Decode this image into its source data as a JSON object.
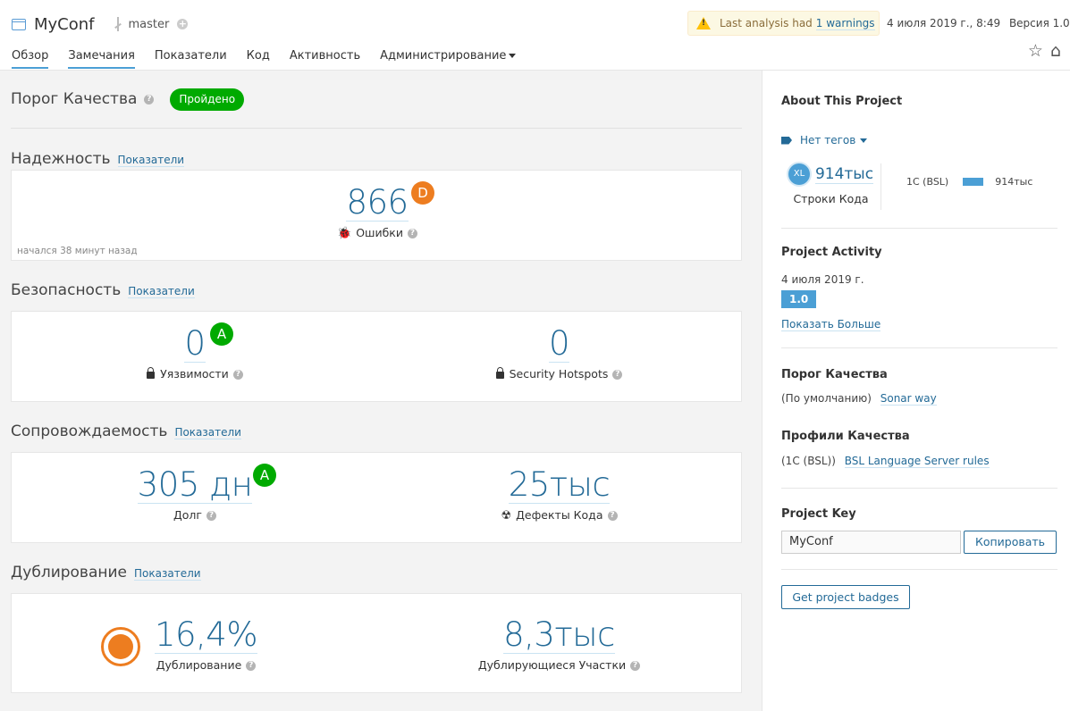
{
  "header": {
    "project_name": "MyConf",
    "branch": "master",
    "warning_text": "Last analysis had",
    "warning_link": "1 warnings",
    "date": "4 июля 2019 г., 8:49",
    "version": "Версия 1.0",
    "nav": [
      "Обзор",
      "Замечания",
      "Показатели",
      "Код",
      "Активность",
      "Администрирование"
    ],
    "icons": [
      "star-icon",
      "home-icon"
    ]
  },
  "quality_gate": {
    "title": "Порог Качества",
    "status": "Пройдено",
    "status_color": "#00aa00"
  },
  "reliability": {
    "title": "Надежность",
    "link": "Показатели",
    "bugs": "866",
    "bugs_rating": "D",
    "bugs_label": "Ошибки",
    "started": "начался 38 минут назад"
  },
  "security": {
    "title": "Безопасность",
    "link": "Показатели",
    "vulnerabilities": "0",
    "vuln_rating": "A",
    "vuln_label": "Уязвимости",
    "hotspots": "0",
    "hotspots_label": "Security Hotspots"
  },
  "maintainability": {
    "title": "Сопровождаемость",
    "link": "Показатели",
    "debt": "305 дн",
    "debt_rating": "A",
    "debt_label": "Долг",
    "smells": "25тыс",
    "smells_label": "Дефекты Кода"
  },
  "duplication": {
    "title": "Дублирование",
    "link": "Показатели",
    "density": "16,4%",
    "density_label": "Дублирование",
    "blocks": "8,3тыс",
    "blocks_label": "Дублирующиеся Участки"
  },
  "sidebar": {
    "about_title": "About This Project",
    "tags": "Нет тегов",
    "size_badge": "XL",
    "loc": "914тыс",
    "loc_label": "Строки Кода",
    "lang_name": "1С (BSL)",
    "lang_loc": "914тыс",
    "activity_title": "Project Activity",
    "activity_date": "4 июля 2019 г.",
    "activity_version": "1.0",
    "show_more": "Показать Больше",
    "qg_title": "Порог Качества",
    "qg_default": "(По умолчанию)",
    "qg_link": "Sonar way",
    "profiles_title": "Профили Качества",
    "profile_lang": "(1С (BSL))",
    "profile_link": "BSL Language Server rules",
    "key_title": "Project Key",
    "key_value": "MyConf",
    "copy_button": "Копировать",
    "badges_button": "Get project badges"
  }
}
